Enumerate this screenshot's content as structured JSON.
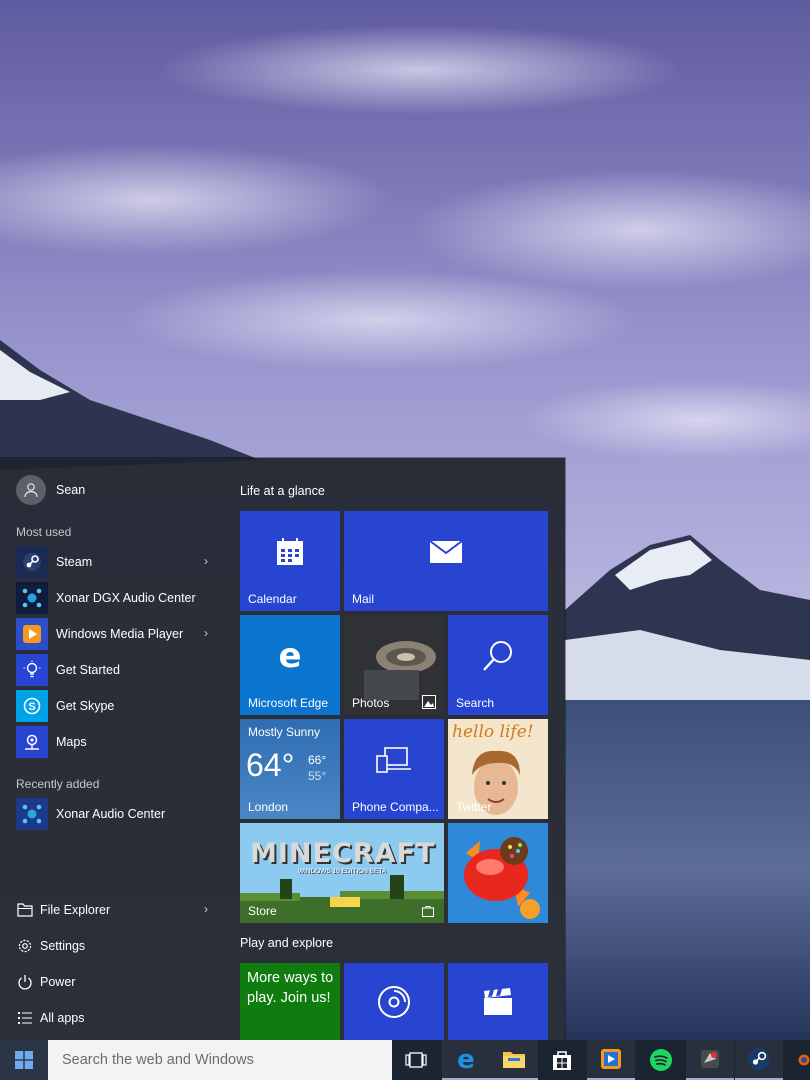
{
  "user": {
    "name": "Sean"
  },
  "sections": {
    "most_used": "Most used",
    "recently_added": "Recently added"
  },
  "most_used": [
    {
      "label": "Steam",
      "icon": "steam-icon"
    },
    {
      "label": "Xonar DGX Audio Center",
      "icon": "xonar-icon"
    },
    {
      "label": "Windows Media Player",
      "icon": "media-player-icon"
    },
    {
      "label": "Get Started",
      "icon": "lightbulb-icon"
    },
    {
      "label": "Get Skype",
      "icon": "skype-icon"
    },
    {
      "label": "Maps",
      "icon": "maps-icon"
    }
  ],
  "recently_added": [
    {
      "label": "Xonar Audio Center",
      "icon": "xonar-icon"
    }
  ],
  "system": {
    "file_explorer": "File Explorer",
    "settings": "Settings",
    "power": "Power",
    "all_apps": "All apps"
  },
  "groups": {
    "life": "Life at a glance",
    "play": "Play and explore"
  },
  "tiles": {
    "calendar": "Calendar",
    "mail": "Mail",
    "edge": "Microsoft Edge",
    "photos": "Photos",
    "search": "Search",
    "weather": {
      "condition": "Mostly Sunny",
      "temp": "64°",
      "high": "66°",
      "low": "55°",
      "city": "London"
    },
    "phone": "Phone Compa...",
    "twitter": "Twitter",
    "twitter_art": "hello life!",
    "store": "Store",
    "minecraft_title": "MINECRAFT",
    "minecraft_sub": "WINDOWS 10 EDITION BETA",
    "xbox_text": "More ways to play. Join us!"
  },
  "taskbar": {
    "search_placeholder": "Search the web and Windows",
    "icons": [
      "windows-icon",
      "task-view-icon",
      "edge-icon",
      "file-explorer-icon",
      "store-icon",
      "media-player-icon",
      "spotify-icon",
      "app-icon",
      "steam-icon",
      "firefox-icon"
    ]
  },
  "colors": {
    "tile_blue": "#2745d0",
    "edge_blue": "#0a74cf",
    "weather_blue": "#1d73c8",
    "xbox_green": "#107c10",
    "menu_bg": "#1f242c"
  }
}
